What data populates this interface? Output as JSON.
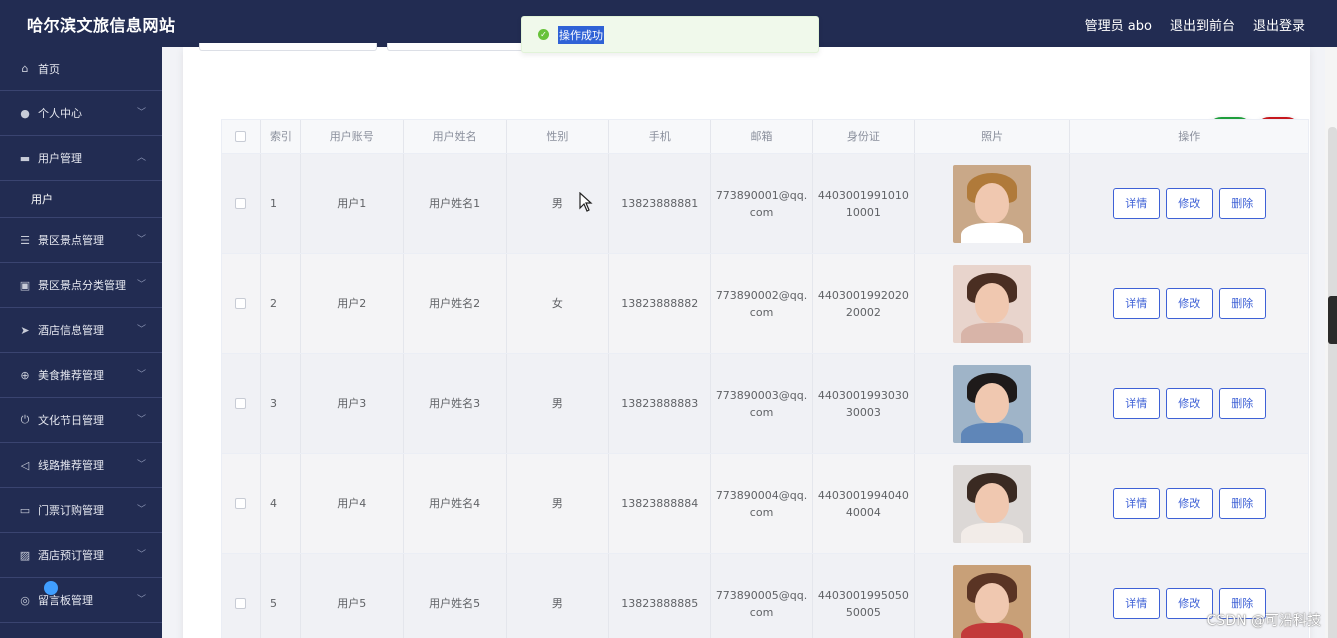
{
  "header": {
    "title": "哈尔滨文旅信息网站",
    "admin": "管理员 abo",
    "to_front": "退出到前台",
    "logout": "退出登录"
  },
  "sidebar": {
    "items": [
      {
        "label": "首页",
        "icon": "home-icon"
      },
      {
        "label": "个人中心",
        "icon": "user-icon"
      },
      {
        "label": "用户管理",
        "icon": "users-icon",
        "expanded": true
      },
      {
        "label": "用户",
        "sub": true
      },
      {
        "label": "景区景点管理",
        "icon": "list-icon"
      },
      {
        "label": "景区景点分类管理",
        "icon": "clipboard-icon"
      },
      {
        "label": "酒店信息管理",
        "icon": "send-icon"
      },
      {
        "label": "美食推荐管理",
        "icon": "compass-icon"
      },
      {
        "label": "文化节日管理",
        "icon": "power-icon"
      },
      {
        "label": "线路推荐管理",
        "icon": "navigation-icon"
      },
      {
        "label": "门票订购管理",
        "icon": "monitor-icon"
      },
      {
        "label": "酒店预订管理",
        "icon": "picture-icon"
      },
      {
        "label": "留言板管理",
        "icon": "globe-icon"
      }
    ]
  },
  "toast": {
    "message": "操作成功",
    "icon": "success-icon"
  },
  "table": {
    "headers": [
      "索引",
      "用户账号",
      "用户姓名",
      "性别",
      "手机",
      "邮箱",
      "身份证",
      "照片",
      "操作"
    ],
    "rows": [
      {
        "idx": "1",
        "account": "用户1",
        "name": "用户姓名1",
        "gender": "男",
        "phone": "13823888881",
        "email": "773890001@qq.com",
        "id_card": "440300199101010001"
      },
      {
        "idx": "2",
        "account": "用户2",
        "name": "用户姓名2",
        "gender": "女",
        "phone": "13823888882",
        "email": "773890002@qq.com",
        "id_card": "440300199202020002"
      },
      {
        "idx": "3",
        "account": "用户3",
        "name": "用户姓名3",
        "gender": "男",
        "phone": "13823888883",
        "email": "773890003@qq.com",
        "id_card": "440300199303030003"
      },
      {
        "idx": "4",
        "account": "用户4",
        "name": "用户姓名4",
        "gender": "男",
        "phone": "13823888884",
        "email": "773890004@qq.com",
        "id_card": "440300199404040004"
      },
      {
        "idx": "5",
        "account": "用户5",
        "name": "用户姓名5",
        "gender": "男",
        "phone": "13823888885",
        "email": "773890005@qq.com",
        "id_card": "440300199505050005"
      }
    ],
    "actions": {
      "detail": "详情",
      "edit": "修改",
      "delete": "删除"
    }
  },
  "toolbar": {
    "add_icon": "plus-icon",
    "delete_icon": "trash-icon"
  },
  "watermark": "CSDN @可沿科技",
  "colors": {
    "nav_bg": "#222c52",
    "primary": "#3e61d6",
    "add_green": "#1f9e3c",
    "delete_red": "#c6171d",
    "success": "#67c23a"
  }
}
